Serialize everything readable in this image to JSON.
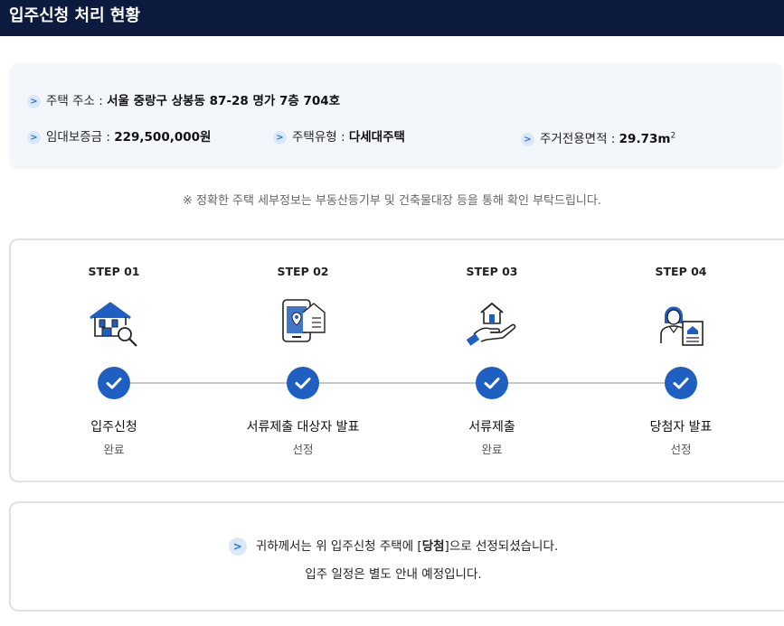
{
  "header": {
    "title": "입주신청 처리 현황"
  },
  "info": {
    "address": {
      "label": "주택 주소 : ",
      "value": "서울 중랑구 상봉동 87-28 명가 7층 704호"
    },
    "deposit": {
      "label": "임대보증금 : ",
      "value": "229,500,000원"
    },
    "house_type": {
      "label": "주택유형 : ",
      "value": "다세대주택"
    },
    "area": {
      "label": "주거전용면적 : ",
      "value": "29.73m",
      "unit_sup": "2"
    }
  },
  "notice": "※ 정확한 주택 세부정보는 부동산등기부 및 건축물대장 등을 통해 확인 부탁드립니다.",
  "steps": [
    {
      "step_label": "STEP 01",
      "title": "입주신청",
      "status": "완료",
      "icon": "house-search-icon"
    },
    {
      "step_label": "STEP 02",
      "title": "서류제출 대상자 발표",
      "status": "선정",
      "icon": "phone-location-document-icon"
    },
    {
      "step_label": "STEP 03",
      "title": "서류제출",
      "status": "완료",
      "icon": "hand-house-icon"
    },
    {
      "step_label": "STEP 04",
      "title": "당첨자 발표",
      "status": "선정",
      "icon": "person-certificate-icon"
    }
  ],
  "result": {
    "line1_before": "귀하께서는 위 입주신청 주택에 [",
    "line1_bold": "당첨",
    "line1_after": "]으로 선정되셨습니다.",
    "line2": "입주 일정은 별도 안내 예정입니다."
  },
  "colors": {
    "header_bg": "#0c1a3d",
    "accent": "#1e5fc1",
    "card_bg": "#f3f7fc"
  }
}
